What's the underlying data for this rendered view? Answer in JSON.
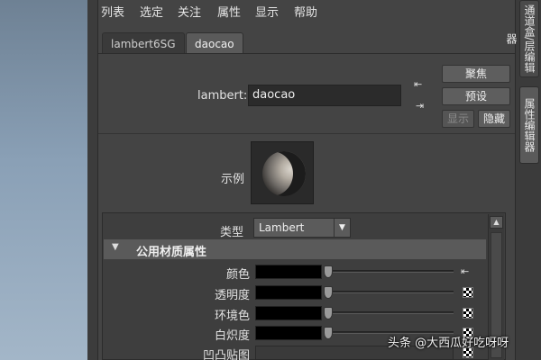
{
  "menu": [
    "列表",
    "选定",
    "关注",
    "属性",
    "显示",
    "帮助"
  ],
  "tabs": [
    {
      "label": "lambert6SG",
      "active": false
    },
    {
      "label": "daocao",
      "active": true
    }
  ],
  "material": {
    "type_label": "lambert:",
    "name_value": "daocao"
  },
  "buttons": {
    "focus": "聚焦",
    "preset": "预设",
    "show": "显示",
    "hide": "隐藏"
  },
  "swatch": {
    "label": "示例"
  },
  "attributes": {
    "type_label": "类型",
    "type_value": "Lambert",
    "section_title": "公用材质属性",
    "rows": [
      {
        "label": "颜色",
        "slider": 0.0
      },
      {
        "label": "透明度",
        "slider": 0.0
      },
      {
        "label": "环境色",
        "slider": 0.0
      },
      {
        "label": "白炽度",
        "slider": 0.0
      }
    ],
    "bump_label": "凹凸贴图"
  },
  "side_tabs": [
    "通道盒/层编辑器",
    "属性编辑器"
  ],
  "watermark": "头条 @大西瓜好吃呀呀",
  "colors": {
    "panel": "#444444",
    "field": "#2b2b2b",
    "color_well": "#000000",
    "active_tab": "#5a5a5a"
  }
}
